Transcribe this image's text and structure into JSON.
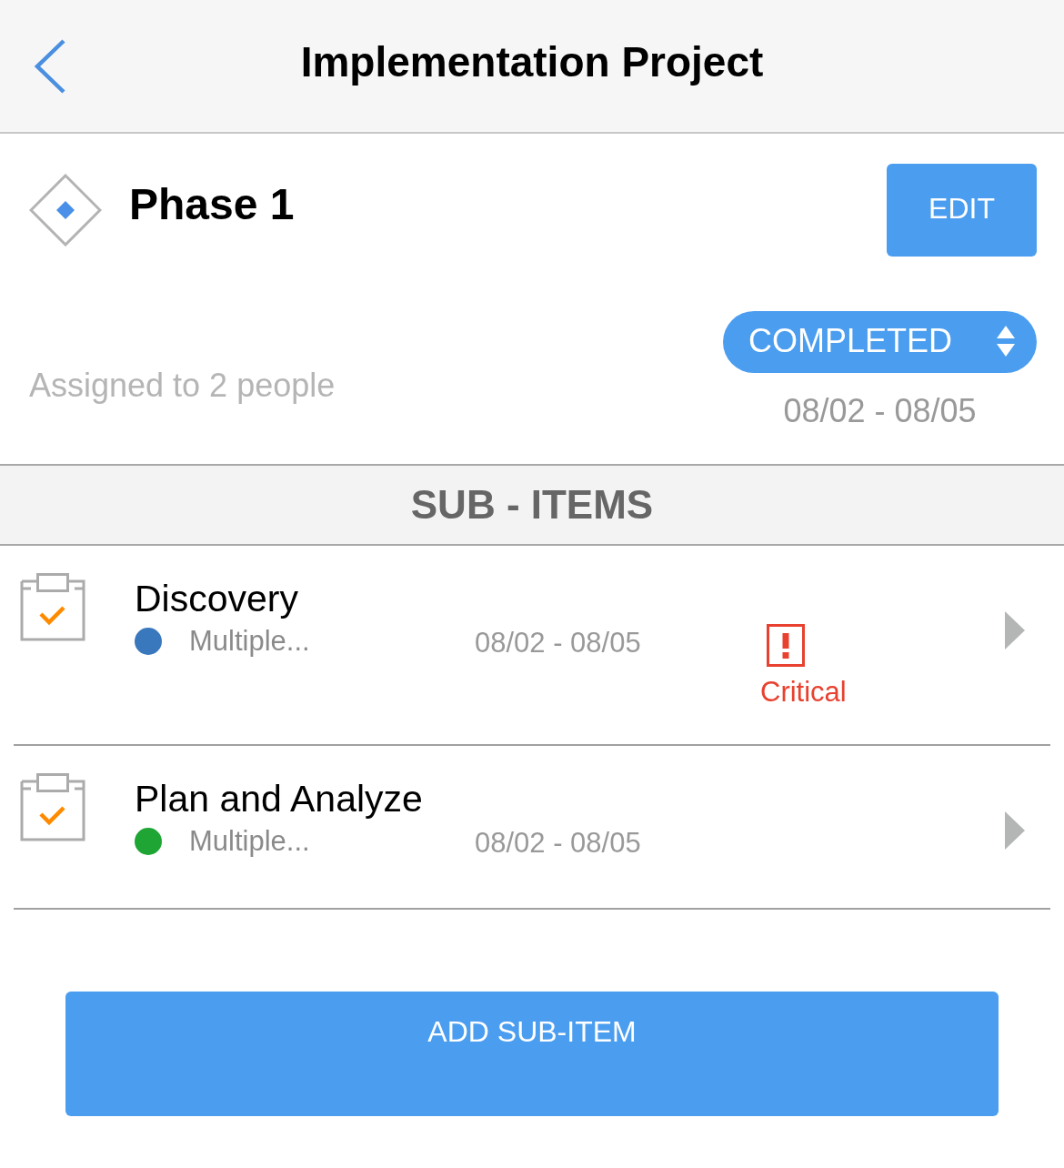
{
  "header": {
    "title": "Implementation Project"
  },
  "phase": {
    "title": "Phase 1",
    "edit_button": "EDIT",
    "status": "COMPLETED",
    "assigned": "Assigned to 2 people",
    "dates": "08/02 - 08/05"
  },
  "section": {
    "title": "SUB - ITEMS"
  },
  "sub_items": [
    {
      "title": "Discovery",
      "color": "#3a78bd",
      "assignee": "Multiple...",
      "dates": "08/02 - 08/05",
      "priority": {
        "label": "Critical"
      }
    },
    {
      "title": "Plan and Analyze",
      "color": "#1ea533",
      "assignee": "Multiple...",
      "dates": "08/02 - 08/05"
    }
  ],
  "add_button": "ADD SUB-ITEM"
}
